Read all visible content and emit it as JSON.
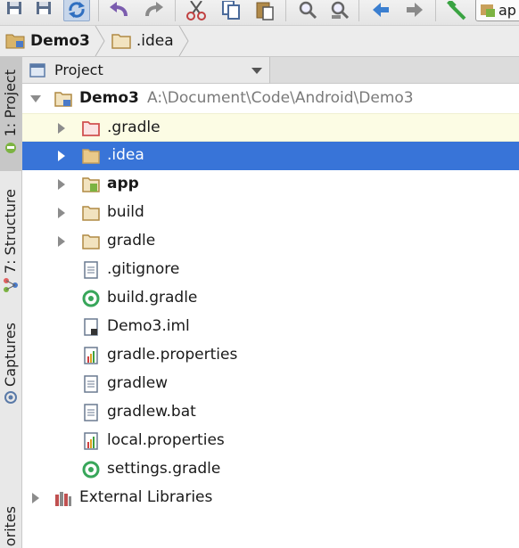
{
  "toolbar": {
    "icons": [
      "save-all-icon",
      "save-icon",
      "sync-icon",
      "undo-icon",
      "redo-icon",
      "cut-icon",
      "copy-icon",
      "paste-icon",
      "find-icon",
      "replace-icon",
      "back-icon",
      "forward-icon",
      "make-project-icon"
    ],
    "run_config_label": "ap"
  },
  "breadcrumb": [
    {
      "label": "Demo3"
    },
    {
      "label": ".idea"
    }
  ],
  "left_strip": {
    "tabs": [
      {
        "label": "1: Project"
      },
      {
        "label": "7: Structure"
      },
      {
        "label": "Captures"
      },
      {
        "label": "orites"
      }
    ]
  },
  "panel": {
    "title": "Project"
  },
  "tree": {
    "root": {
      "label": "Demo3",
      "path": "A:\\Document\\Code\\Android\\Demo3"
    },
    "items": [
      {
        "label": ".gradle",
        "type": "folder-excluded"
      },
      {
        "label": ".idea",
        "type": "folder"
      },
      {
        "label": "app",
        "type": "module"
      },
      {
        "label": "build",
        "type": "folder"
      },
      {
        "label": "gradle",
        "type": "folder"
      },
      {
        "label": ".gitignore",
        "type": "text-file"
      },
      {
        "label": "build.gradle",
        "type": "gradle-file"
      },
      {
        "label": "Demo3.iml",
        "type": "iml-file"
      },
      {
        "label": "gradle.properties",
        "type": "properties-file"
      },
      {
        "label": "gradlew",
        "type": "text-file"
      },
      {
        "label": "gradlew.bat",
        "type": "text-file"
      },
      {
        "label": "local.properties",
        "type": "properties-file"
      },
      {
        "label": "settings.gradle",
        "type": "gradle-file"
      }
    ],
    "external": {
      "label": "External Libraries"
    }
  },
  "colors": {
    "selection": "#3874d8",
    "folder": "#c8a05a",
    "excluded_folder": "#d05050",
    "gradle_green": "#38a65a"
  }
}
